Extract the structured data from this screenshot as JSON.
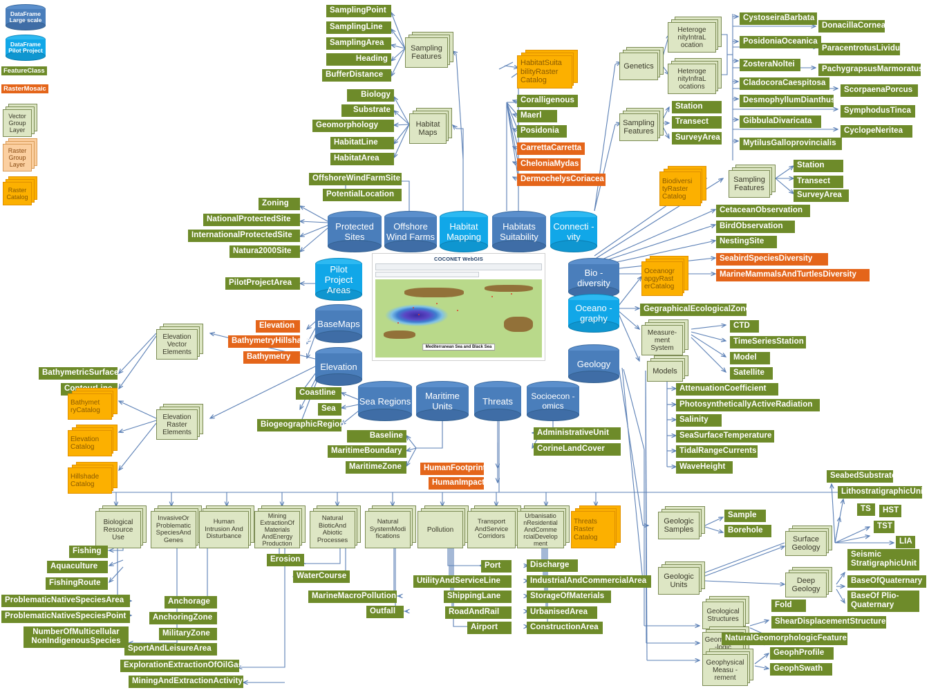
{
  "legend": {
    "items": [
      {
        "name": "DataFrame Large scale",
        "type": "cylinder-dark"
      },
      {
        "name": "DataFrame Pilot Project",
        "type": "cylinder-light"
      },
      {
        "name": "FeatureClass",
        "type": "green-box"
      },
      {
        "name": "RasterMosaic",
        "type": "orange-box"
      },
      {
        "name": "Vector Group Layer",
        "type": "vector-group"
      },
      {
        "name": "Raster Group Layer",
        "type": "raster-group"
      },
      {
        "name": "Raster Catalog",
        "type": "raster-catalog"
      }
    ]
  },
  "colors": {
    "feature_class": "#6e8b2a",
    "raster_mosaic": "#e4651a",
    "vector_group_layer": "#dde6c4",
    "raster_group_layer": "#fbcfa0",
    "raster_catalog": "#fcb000",
    "dataframe_large": "#4a7ebb",
    "dataframe_pilot": "#11a7e8",
    "connector": "#5a7fb5"
  },
  "map": {
    "title": "COCONET WebGIS",
    "caption": "Mediterranean Sea and Black Sea"
  },
  "cylinders": [
    {
      "id": "protected-sites",
      "label": "Protected Sites",
      "variant": "dark"
    },
    {
      "id": "offshore-wind-farms",
      "label": "Offshore Wind Farms",
      "variant": "dark"
    },
    {
      "id": "habitat-mapping",
      "label": "Habitat Mapping",
      "variant": "pilot"
    },
    {
      "id": "habitats-suitability",
      "label": "Habitats Suitability",
      "variant": "dark"
    },
    {
      "id": "connectivity",
      "label": "Connecti -vity",
      "variant": "pilot"
    },
    {
      "id": "pilot-project-areas",
      "label": "Pilot Project Areas",
      "variant": "pilot"
    },
    {
      "id": "basemaps",
      "label": "BaseMaps",
      "variant": "dark"
    },
    {
      "id": "elevation",
      "label": "Elevation",
      "variant": "dark"
    },
    {
      "id": "sea-regions",
      "label": "Sea Regions",
      "variant": "dark"
    },
    {
      "id": "maritime-units",
      "label": "Maritime Units",
      "variant": "dark"
    },
    {
      "id": "threats",
      "label": "Threats",
      "variant": "dark"
    },
    {
      "id": "socioeconomics",
      "label": "Socioecon -omics",
      "variant": "dark"
    },
    {
      "id": "biodiversity",
      "label": "Bio -diversity",
      "variant": "dark"
    },
    {
      "id": "oceanography",
      "label": "Oceano -graphy",
      "variant": "pilot"
    },
    {
      "id": "geology",
      "label": "Geology",
      "variant": "dark"
    }
  ],
  "group_layers": {
    "sampling_features_habitat": "Sampling Features",
    "habitat_maps": "Habitat Maps",
    "genetics": "Genetics",
    "sampling_features_genetics": "Sampling Features",
    "heterogeneity_intra": "Heteroge nityIntraL ocation",
    "heterogeneity_infra": "Heteroge nityInfraL ocations",
    "sampling_features_bio": "Sampling Features",
    "measurement_system": "Measure- ment System",
    "models": "Models",
    "elevation_vector_elements": "Elevation Vector Elements",
    "elevation_raster_elements": "Elevation Raster Elements",
    "geologic_samples": "Geologic Samples",
    "geologic_units": "Geologic Units",
    "surface_geology": "Surface Geology",
    "deep_geology": "Deep Geology",
    "geological_structures": "Geological Structures",
    "geomorphologic_features": "Geomorpho -logic Features",
    "geophysical_measurement": "Geophysical Measu -rement",
    "biological_resource_use": "Biological Resource Use",
    "invasive_species": "InvasiveOr Problematic SpeciesAnd Genes",
    "human_intrusion": "Human Intrusion And Disturbance",
    "mining_extraction": "Mining ExtractionOf Materials AndEnergy Production",
    "natural_biotic": "Natural BioticAnd Abiotic Processes",
    "natural_system_mod": "Natural SystemModi fications",
    "pollution": "Pollution",
    "transport_corridors": "Transport AndService Corridors",
    "urbanisation": "Urbanisatio nResidential AndComme rcialDevelop ment"
  },
  "raster_catalogs": {
    "habitat_suitability": "HabitatSuita bilityRaster Catalog",
    "biodiversity": "Biodiversi tyRaster Catalog",
    "oceanography": "Oceanogr apgyRast erCatalog",
    "bathymetry": "Bathymet ryCatalog",
    "elevation": "Elevation Catalog",
    "hillshade": "Hillshade Catalog",
    "threats": "Threats Raster Catalog"
  },
  "feature_classes": {
    "sampling_point": "SamplingPoint",
    "sampling_line": "SamplingLine",
    "sampling_area": "SamplingArea",
    "heading": "Heading",
    "buffer_distance": "BufferDistance",
    "biology": "Biology",
    "substrate": "Substrate",
    "geomorphology": "Geomorphology",
    "habitat_line": "HabitatLine",
    "habitat_area": "HabitatArea",
    "offshore_wind_farm_site": "OffshoreWindFarmSite",
    "potential_location": "PotentialLocation",
    "coralligenous": "Coralligenous",
    "maerl": "Maerl",
    "posidonia": "Posidonia",
    "station_gen": "Station",
    "transect_gen": "Transect",
    "survey_area_gen": "SurveyArea",
    "cystoseira_barbata": "CystoseiraBarbata",
    "donacilla_cornea": "DonacillaCornea",
    "posidonia_oceanica": "PosidoniaOceanica",
    "paracentrotus_lividus": "ParacentrotusLividus",
    "zostera_noltei": "ZosteraNoltei",
    "pachygrapsus_marmoratus": "PachygrapsusMarmoratus",
    "cladocora_caespitosa": "CladocoraCaespitosa",
    "scorpaena_porcus": "ScorpaenaPorcus",
    "desmophyllum_dianthus": "DesmophyllumDianthus",
    "symphodus_tinca": "SymphodusTinca",
    "gibbula_divaricata": "GibbulaDivaricata",
    "cyclope_neritea": "CyclopeNeritea",
    "mytilus_galloprovincialis": "MytilusGalloprovincialis",
    "station_bio": "Station",
    "transect_bio": "Transect",
    "survey_area_bio": "SurveyArea",
    "cetacean_observation": "CetaceanObservation",
    "bird_observation": "BirdObservation",
    "nesting_site": "NestingSite",
    "geographical_ecological_zone": "GegraphicalEcologicalZone",
    "ctd": "CTD",
    "time_series_station": "TimeSeriesStation",
    "model": "Model",
    "satellite": "Satellite",
    "attenuation_coefficient": "AttenuationCoefficient",
    "par": "PhotosyntheticallyActiveRadiation",
    "salinity": "Salinity",
    "sst": "SeaSurfaceTemperature",
    "tidal_range_currents": "TidalRangeCurrents",
    "wave_height": "WaveHeight",
    "zoning": "Zoning",
    "national_protected_site": "NationalProtectedSite",
    "international_protected_site": "InternationalProtectedSite",
    "natura_2000_site": "Natura2000Site",
    "pilot_project_area": "PilotProjectArea",
    "bathymetric_surface": "BathymetricSurface",
    "contour_line": "ContourLine",
    "coastline": "Coastline",
    "sea": "Sea",
    "biogeographic_region": "BiogeographicRegion",
    "baseline": "Baseline",
    "maritime_boundary": "MaritimeBoundary",
    "maritime_zone": "MaritimeZone",
    "administrative_unit": "AdministrativeUnit",
    "corine_land_cover": "CorineLandCover",
    "sample": "Sample",
    "borehole": "Borehole",
    "seabed_substrate": "SeabedSubstrate",
    "lithostratigraphic_unit": "LithostratigraphicUnit",
    "ts": "TS",
    "hst": "HST",
    "tst": "TST",
    "lia": "LIA",
    "seismic_stratigraphic_unit": "Seismic StratigraphicUnit",
    "base_of_quaternary": "BaseOfQuaternary",
    "base_of_plio_quaternary": "BaseOf Plio-Quaternary",
    "fold": "Fold",
    "shear_displacement_structure": "ShearDisplacementStructure",
    "natural_geomorphologic_feature": "NaturalGeomorphologicFeature",
    "geoph_profile": "GeophProfile",
    "geoph_swath": "GeophSwath",
    "fishing": "Fishing",
    "aquaculture": "Aquaculture",
    "fishing_route": "FishingRoute",
    "problematic_native_species_area": "ProblematicNativeSpeciesArea",
    "problematic_native_species_point": "ProblematicNativeSpeciesPoint",
    "number_of_multicellular": "NumberOfMulticellular NonIndigenousSpecies",
    "anchorage": "Anchorage",
    "anchoring_zone": "AnchoringZone",
    "military_zone": "MilitaryZone",
    "sport_and_leisure_area": "SportAndLeisureArea",
    "exploration_extraction_oil_gas": "ExplorationExtractionOfOilGas",
    "mining_and_extraction_activity": "MiningAndExtractionActivity",
    "erosion": "Erosion",
    "water_course": "WaterCourse",
    "marine_macro_pollution": "MarineMacroPollution",
    "outfall": "Outfall",
    "port": "Port",
    "utility_and_service_line": "UtilityAndServiceLine",
    "shipping_lane": "ShippingLane",
    "road_and_rail": "RoadAndRail",
    "airport": "Airport",
    "discharge": "Discharge",
    "industrial_and_commercial_area": "IndustrialAndCommercialArea",
    "storage_of_materials": "StorageOfMaterials",
    "urbanised_area": "UrbanisedArea",
    "construction_area": "ConstructionArea"
  },
  "raster_mosaics": {
    "carretta_carretta": "CarrettaCarretta",
    "chelonia_mydas": "CheloniaMydas",
    "dermochelys_coriacea": "DermochelysCoriacea",
    "seabird_species_diversity": "SeabirdSpeciesDiversity",
    "marine_mammals_turtles": "MarineMammalsAndTurtlesDiversity",
    "elevation": "Elevation",
    "bathymetry_hillshade": "BathymetryHillshade",
    "bathymetry": "Bathymetry",
    "human_footprint": "HumanFootprint",
    "human_impact": "HumanImpact"
  }
}
